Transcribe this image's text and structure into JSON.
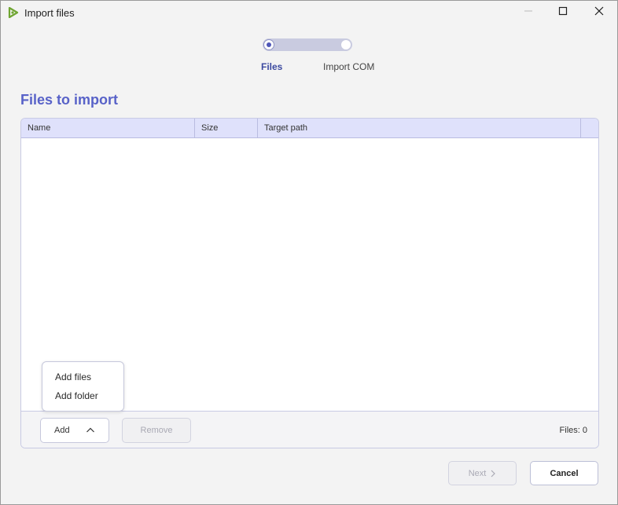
{
  "window": {
    "title": "Import files",
    "controls": {
      "minimize": "minimize-icon",
      "maximize": "maximize-icon",
      "close": "close-icon"
    }
  },
  "stepper": {
    "steps": [
      {
        "label": "Files",
        "active": true
      },
      {
        "label": "Import COM",
        "active": false
      }
    ]
  },
  "heading": "Files to import",
  "table": {
    "columns": [
      "Name",
      "Size",
      "Target path"
    ],
    "rows": []
  },
  "footer": {
    "add_label": "Add",
    "remove_label": "Remove",
    "files_count": "Files: 0"
  },
  "add_menu": {
    "items": [
      "Add files",
      "Add folder"
    ]
  },
  "actions": {
    "next_label": "Next",
    "cancel_label": "Cancel"
  },
  "colors": {
    "accent": "#5862c8",
    "header_bg": "#dfe1fb",
    "app_icon": "#6fa531"
  }
}
